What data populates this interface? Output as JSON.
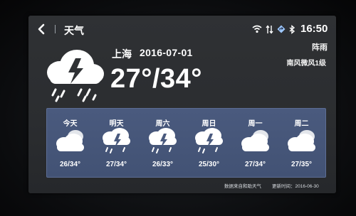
{
  "header": {
    "title": "天气",
    "time": "16:50",
    "status_icons": [
      "wifi-icon",
      "signal-arrows-icon",
      "navigation-icon",
      "bluetooth-icon"
    ]
  },
  "current": {
    "city": "上海",
    "date": "2016-07-01",
    "temp_range": "27°/34°",
    "condition": "阵雨",
    "wind": "南风微风1级",
    "icon": "thunderstorm-rain-icon"
  },
  "forecast": [
    {
      "day": "今天",
      "icon": "cloudy-icon",
      "temp": "26/34°"
    },
    {
      "day": "明天",
      "icon": "thunderstorm-icon",
      "temp": "27/34°"
    },
    {
      "day": "周六",
      "icon": "thunderstorm-icon",
      "temp": "26/33°"
    },
    {
      "day": "周日",
      "icon": "thunderstorm-icon",
      "temp": "25/30°"
    },
    {
      "day": "周一",
      "icon": "cloudy-icon",
      "temp": "27/34°"
    },
    {
      "day": "周二",
      "icon": "cloudy-icon",
      "temp": "27/35°"
    }
  ],
  "footer": {
    "source": "数据来自和助天气",
    "updated": "更新时间：2016-06-30"
  },
  "colors": {
    "screen_bg": "#2f3134",
    "forecast_panel_bg": "#4a5a7e",
    "text": "#ffffff"
  }
}
